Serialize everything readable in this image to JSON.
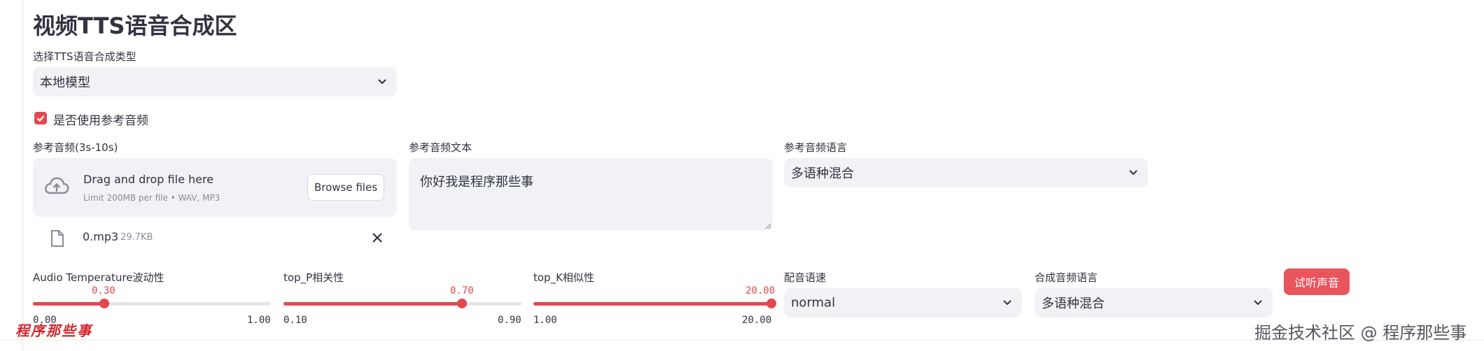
{
  "page": {
    "title": "视频TTS语音合成区"
  },
  "tts_type": {
    "label": "选择TTS语音合成类型",
    "value": "本地模型"
  },
  "use_reference": {
    "label": "是否使用参考音频",
    "checked": true
  },
  "ref_audio": {
    "label": "参考音频(3s-10s)",
    "dropzone_text": "Drag and drop file here",
    "dropzone_limit": "Limit 200MB per file • WAV, MP3",
    "browse_label": "Browse files",
    "file": {
      "name": "0.mp3",
      "size": "29.7KB"
    }
  },
  "ref_text": {
    "label": "参考音频文本",
    "value": "你好我是程序那些事"
  },
  "ref_lang": {
    "label": "参考音频语言",
    "value": "多语种混合"
  },
  "sliders": [
    {
      "label": "Audio Temperature波动性",
      "value": "0.30",
      "min": "0.00",
      "max": "1.00",
      "fraction": 0.3
    },
    {
      "label": "top_P相关性",
      "value": "0.70",
      "min": "0.10",
      "max": "0.90",
      "fraction": 0.75
    },
    {
      "label": "top_K相似性",
      "value": "20.00",
      "min": "1.00",
      "max": "20.00",
      "fraction": 1.0
    }
  ],
  "speed": {
    "label": "配音语速",
    "value": "normal"
  },
  "synth_lang": {
    "label": "合成音频语言",
    "value": "多语种混合"
  },
  "preview_button": "试听声音",
  "watermark_left": "程序那些事",
  "watermark_right": "掘金技术社区 @ 程序那些事",
  "colors": {
    "accent": "#e2494f",
    "input_bg": "#f0f2f6",
    "text": "#31333f"
  },
  "icons": [
    "chevron-down-icon",
    "check-icon",
    "cloud-upload-icon",
    "file-icon",
    "close-icon"
  ]
}
